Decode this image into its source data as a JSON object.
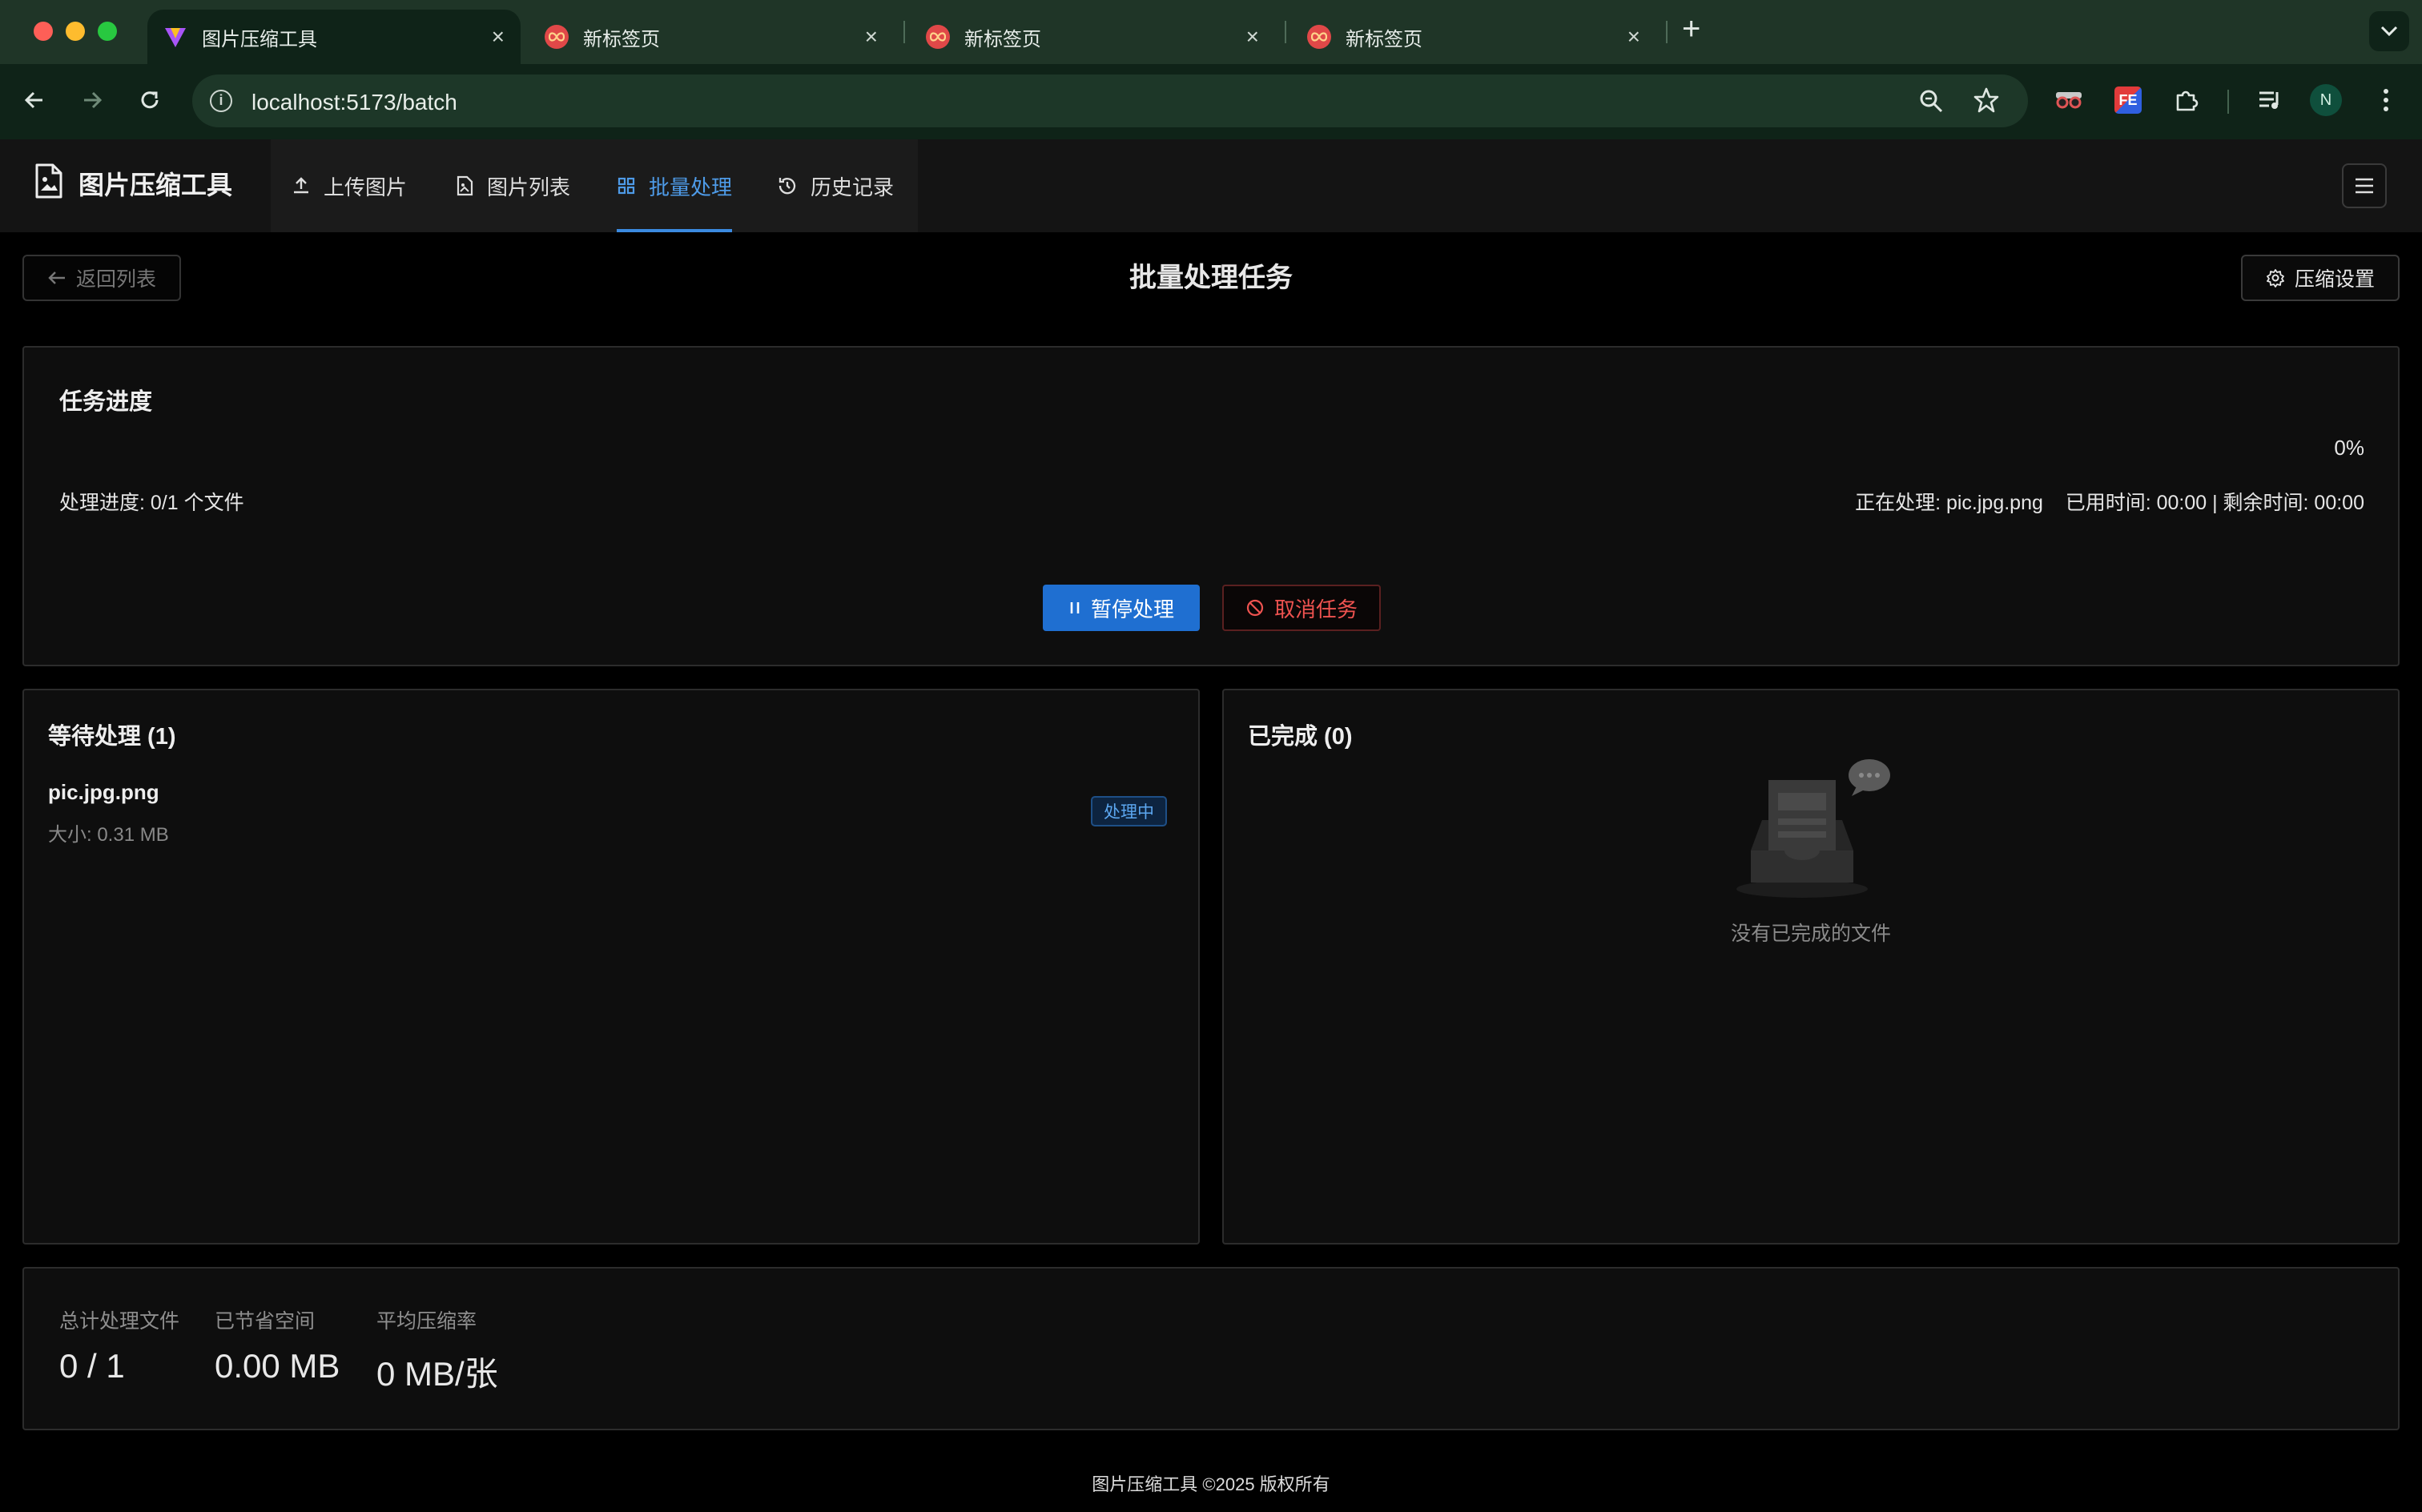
{
  "browser": {
    "tabs": [
      {
        "title": "图片压缩工具",
        "active": true
      },
      {
        "title": "新标签页",
        "active": false
      },
      {
        "title": "新标签页",
        "active": false
      },
      {
        "title": "新标签页",
        "active": false
      }
    ],
    "url": "localhost:5173/batch",
    "profile_initial": "N",
    "extension_fe_label": "FE"
  },
  "app": {
    "name": "图片压缩工具",
    "nav": [
      {
        "label": "上传图片",
        "icon": "upload-icon",
        "active": false
      },
      {
        "label": "图片列表",
        "icon": "file-image-icon",
        "active": false
      },
      {
        "label": "批量处理",
        "icon": "grid-icon",
        "active": true
      },
      {
        "label": "历史记录",
        "icon": "history-icon",
        "active": false
      }
    ]
  },
  "page": {
    "back_label": "返回列表",
    "title": "批量处理任务",
    "settings_label": "压缩设置"
  },
  "progress": {
    "title": "任务进度",
    "percent": "0%",
    "percent_value": 0,
    "summary": "处理进度: 0/1 个文件",
    "current": "正在处理: pic.jpg.png",
    "time": "已用时间: 00:00 | 剩余时间: 00:00",
    "pause_label": "暂停处理",
    "cancel_label": "取消任务"
  },
  "queue": {
    "title": "等待处理 (1)",
    "items": [
      {
        "name": "pic.jpg.png",
        "size": "大小: 0.31 MB",
        "status": "处理中"
      }
    ]
  },
  "completed": {
    "title": "已完成 (0)",
    "empty_text": "没有已完成的文件"
  },
  "stats": [
    {
      "label": "总计处理文件",
      "value": "0 / 1"
    },
    {
      "label": "已节省空间",
      "value": "0.00 MB"
    },
    {
      "label": "平均压缩率",
      "value": "0 MB/张"
    }
  ],
  "footer": "图片压缩工具 ©2025 版权所有",
  "colors": {
    "accent": "#3b8ae0",
    "primary_button": "#1f6fd1",
    "danger": "#ef5350",
    "chrome_bg": "#1f3527"
  }
}
